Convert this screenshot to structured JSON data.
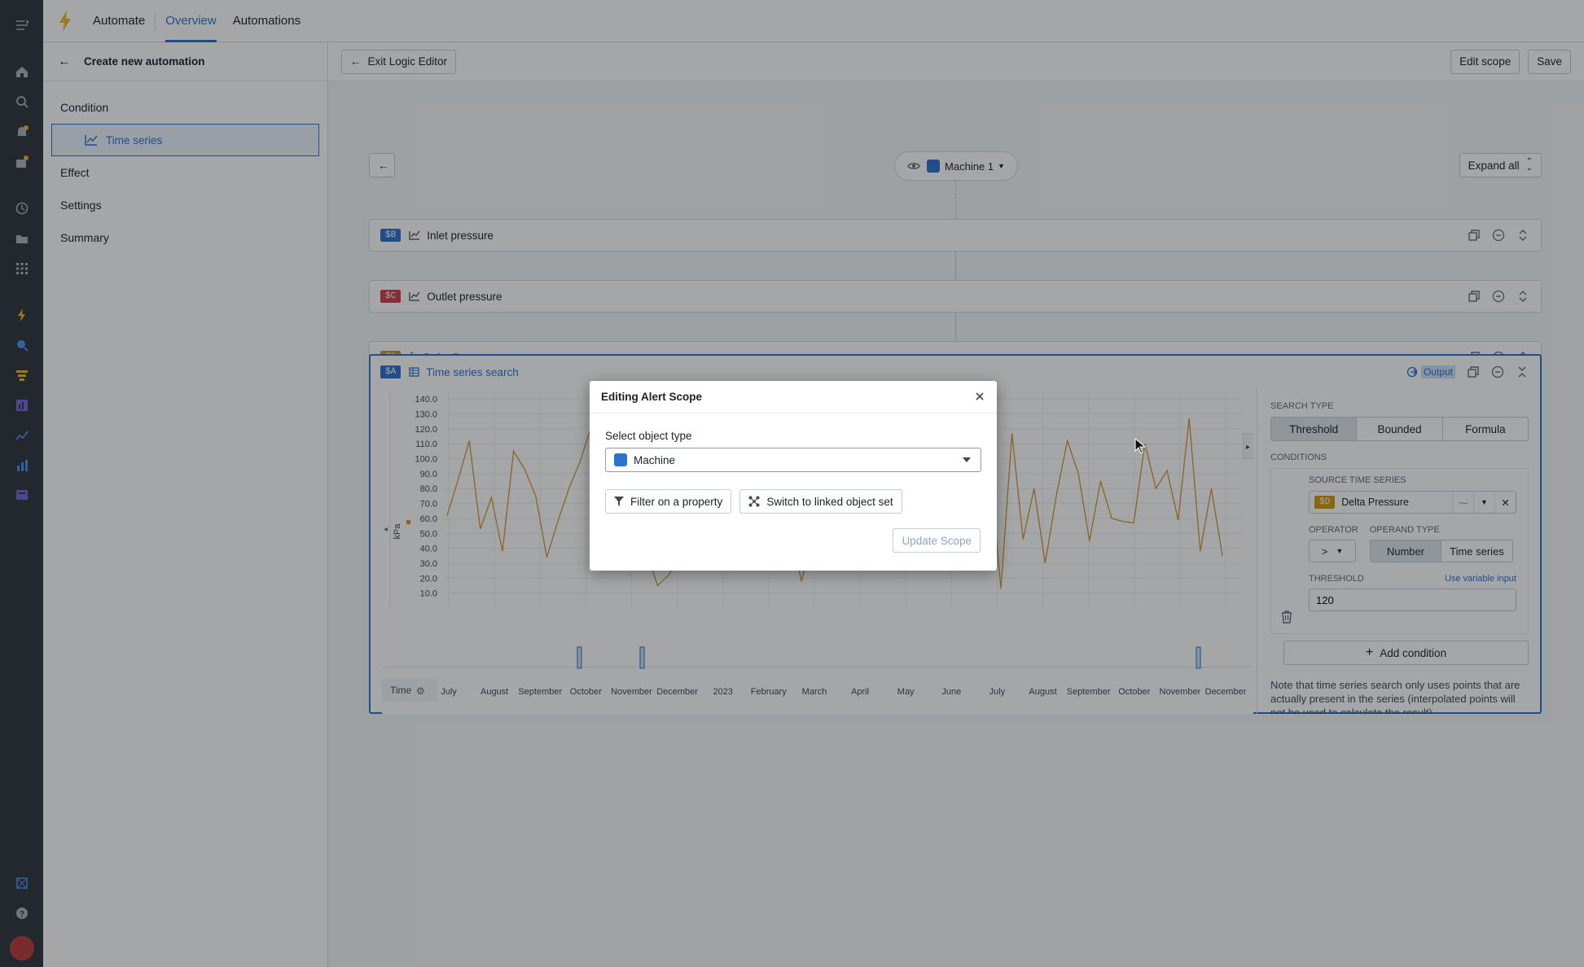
{
  "topbar": {
    "tabs": [
      "Automate",
      "Overview",
      "Automations"
    ],
    "active_tab": "Overview"
  },
  "sidebar": {
    "title": "Create new automation",
    "items": {
      "condition": "Condition",
      "time_series": "Time series",
      "effect": "Effect",
      "settings": "Settings",
      "summary": "Summary"
    }
  },
  "mainbar": {
    "exit_label": "Exit Logic Editor",
    "edit_scope_label": "Edit scope",
    "save_label": "Save"
  },
  "canvas": {
    "object_label": "Machine 1",
    "expand_all_label": "Expand all",
    "cards": [
      {
        "badge": "$B",
        "badge_color": "#2d72d2",
        "icon": "line-chart-icon",
        "label": "Inlet pressure"
      },
      {
        "badge": "$C",
        "badge_color": "#cd4246",
        "icon": "line-chart-icon",
        "label": "Outlet pressure"
      },
      {
        "badge": "$D",
        "badge_color": "#d1980b",
        "icon": "function-icon",
        "label": "Delta Pressure"
      }
    ],
    "search_card": {
      "badge": "$A",
      "badge_color": "#2d72d2",
      "label": "Time series search",
      "output_label": "Output"
    }
  },
  "chart_data": {
    "type": "line",
    "ylabel": "kPa",
    "xlabel": "Time",
    "ylim": [
      0,
      145
    ],
    "yticks": [
      "140.0",
      "130.0",
      "120.0",
      "110.0",
      "100.0",
      "90.0",
      "80.0",
      "70.0",
      "60.0",
      "50.0",
      "40.0",
      "30.0",
      "20.0",
      "10.0"
    ],
    "xticks": [
      "July",
      "August",
      "September",
      "October",
      "November",
      "December",
      "2023",
      "February",
      "March",
      "April",
      "May",
      "June",
      "July",
      "August",
      "September",
      "October",
      "November",
      "December"
    ],
    "series": [
      {
        "color": "#d9922e",
        "values": [
          62,
          86,
          112,
          53,
          74,
          38,
          105,
          93,
          75,
          34,
          58,
          80,
          98,
          121,
          88,
          70,
          48,
          42,
          38,
          15,
          22,
          34,
          60,
          85,
          94,
          58,
          25,
          52,
          35,
          48,
          26,
          52,
          18,
          48,
          30,
          52,
          30,
          40,
          45,
          35,
          48,
          75,
          48,
          43,
          62,
          92,
          68,
          45,
          60,
          96,
          13,
          117,
          46,
          80,
          30,
          75,
          112,
          90,
          45,
          85,
          60,
          58,
          57,
          110,
          80,
          92,
          59,
          127,
          38,
          80,
          35
        ]
      }
    ]
  },
  "right_panel": {
    "search_type_label": "SEARCH TYPE",
    "search_types": [
      "Threshold",
      "Bounded",
      "Formula"
    ],
    "active_search_type": "Threshold",
    "conditions_label": "CONDITIONS",
    "source_label": "SOURCE TIME SERIES",
    "source_badge": "$D",
    "source_badge_color": "#d1980b",
    "source_value": "Delta Pressure",
    "operator_label": "OPERATOR",
    "operator_value": ">",
    "operand_type_label": "OPERAND TYPE",
    "operand_types": [
      "Number",
      "Time series"
    ],
    "active_operand_type": "Number",
    "threshold_label": "THRESHOLD",
    "variable_link": "Use variable input",
    "threshold_value": "120",
    "add_condition_label": "Add condition",
    "note": "Note that time series search only uses points that are actually present in the series (interpolated points will not be used to calculate the result)."
  },
  "dialog": {
    "title": "Editing Alert Scope",
    "select_label": "Select object type",
    "selected_type": "Machine",
    "filter_label": "Filter on a property",
    "switch_label": "Switch to linked object set",
    "update_label": "Update Scope"
  }
}
